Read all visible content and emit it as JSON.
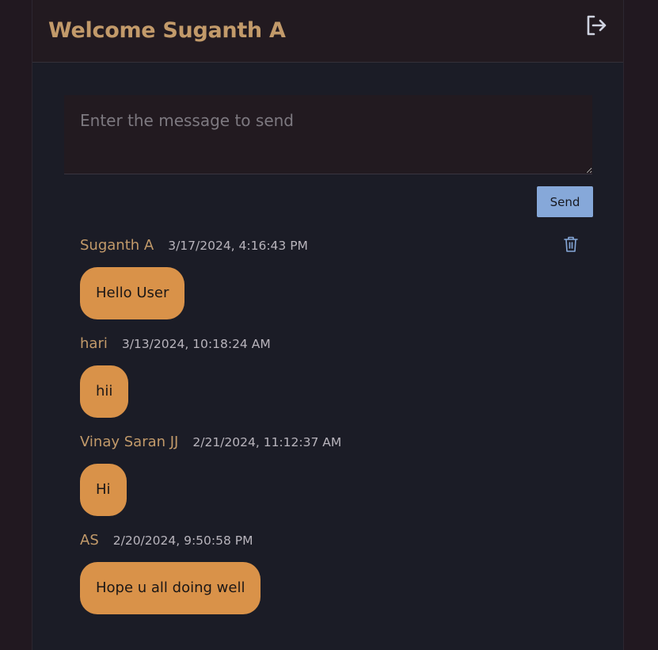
{
  "header": {
    "title": "Welcome Suganth A",
    "logout_icon": "logout-icon"
  },
  "composer": {
    "placeholder": "Enter the message to send",
    "value": ""
  },
  "send_label": "Send",
  "colors": {
    "page_bg": "#211820",
    "panel_bg": "#1b1c26",
    "header_bg": "#221a20",
    "accent_gold": "#c29a6a",
    "bubble_orange": "#d99249",
    "send_blue": "#86a8d9"
  },
  "messages": [
    {
      "author": "Suganth A",
      "time": "3/17/2024, 4:16:43 PM",
      "text": "Hello User",
      "deletable": true
    },
    {
      "author": "hari",
      "time": "3/13/2024, 10:18:24 AM",
      "text": "hii",
      "deletable": false
    },
    {
      "author": "Vinay Saran JJ",
      "time": "2/21/2024, 11:12:37 AM",
      "text": "Hi",
      "deletable": false
    },
    {
      "author": "AS",
      "time": "2/20/2024, 9:50:58 PM",
      "text": "Hope u all doing well",
      "deletable": false
    }
  ]
}
